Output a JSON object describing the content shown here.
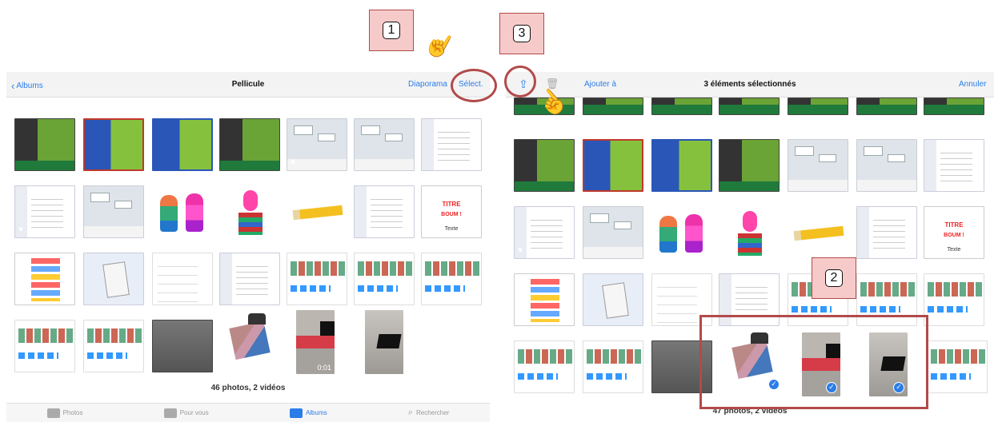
{
  "left_panel": {
    "nav": {
      "back": "Albums",
      "title": "Pellicule",
      "slideshow": "Diaporama",
      "select": "Sélect."
    },
    "count": "46 photos, 2 vidéos",
    "tabs": [
      {
        "label": "Photos",
        "icon": "photos-icon"
      },
      {
        "label": "Pour vous",
        "icon": "for-you-icon"
      },
      {
        "label": "Albums",
        "icon": "albums-icon",
        "active": true
      },
      {
        "label": "Rechercher",
        "icon": "search-icon"
      }
    ],
    "video_duration": "0:01"
  },
  "right_panel": {
    "nav": {
      "add_to": "Ajouter à",
      "title": "3 éléments sélectionnés",
      "cancel": "Annuler"
    },
    "count": "47 photos, 2 vidéos"
  },
  "thumbnail_text": {
    "titre": "TITRE",
    "boum": "BOUM !",
    "texte": "Texte"
  },
  "callouts": {
    "one": "1",
    "two": "2",
    "three": "3"
  },
  "colors": {
    "accent": "#2b7de9",
    "annotation": "#b24a4a",
    "callout_bg": "#f7caca"
  }
}
